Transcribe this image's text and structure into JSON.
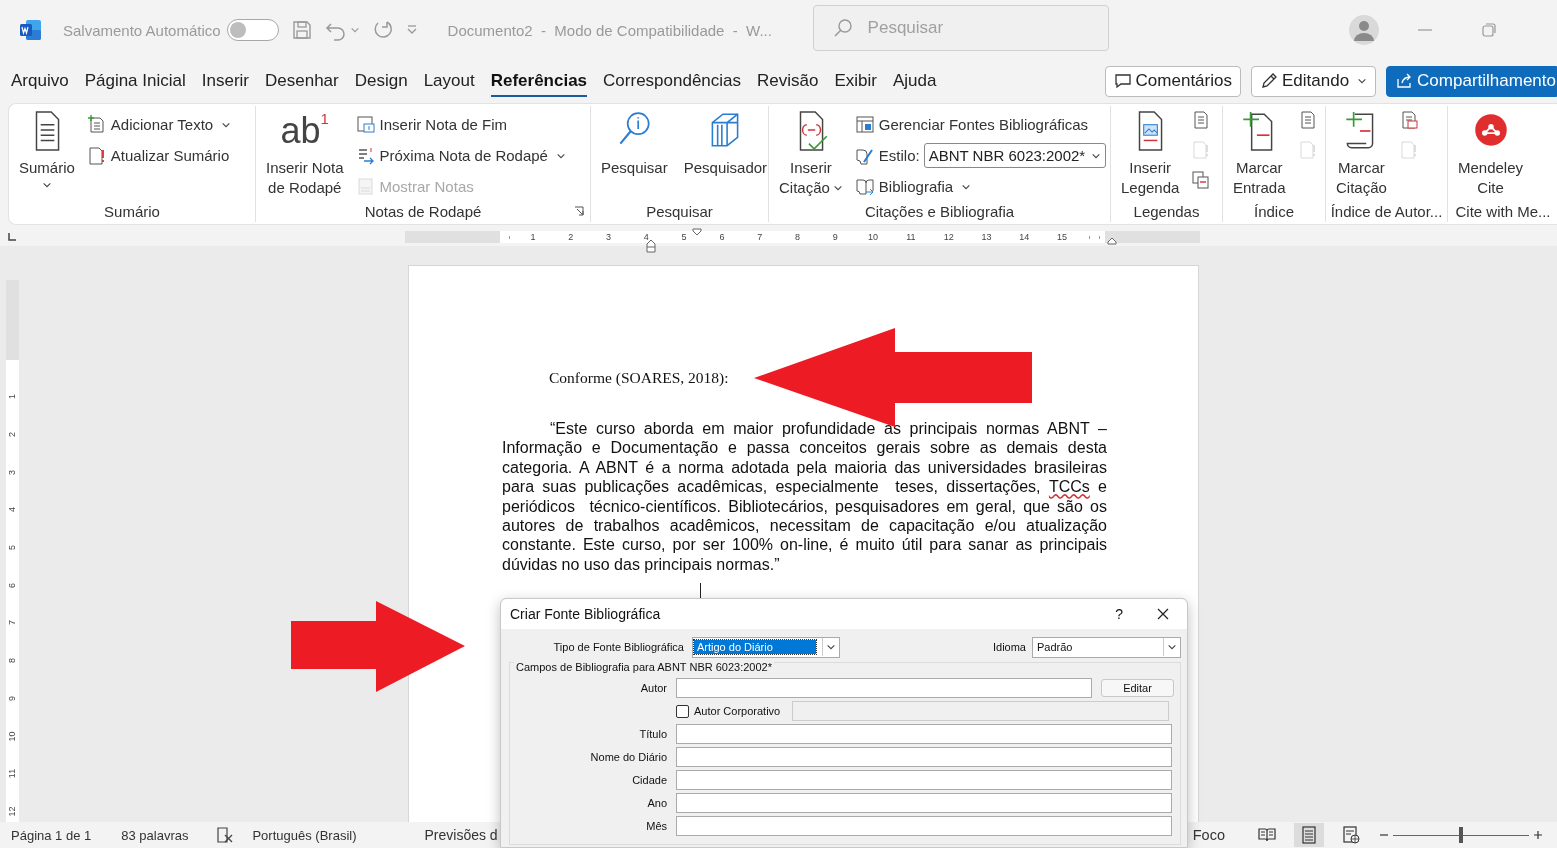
{
  "title_bar": {
    "autosave_label": "Salvamento Automático",
    "autosave_on": false,
    "document_title": "Documento2  -  Modo de Compatibilidade  -  W...",
    "search_placeholder": "Pesquisar"
  },
  "tabs": [
    {
      "label": "Arquivo",
      "selected": false
    },
    {
      "label": "Página Inicial",
      "selected": false
    },
    {
      "label": "Inserir",
      "selected": false
    },
    {
      "label": "Desenhar",
      "selected": false
    },
    {
      "label": "Design",
      "selected": false
    },
    {
      "label": "Layout",
      "selected": false
    },
    {
      "label": "Referências",
      "selected": true
    },
    {
      "label": "Correspondências",
      "selected": false
    },
    {
      "label": "Revisão",
      "selected": false
    },
    {
      "label": "Exibir",
      "selected": false
    },
    {
      "label": "Ajuda",
      "selected": false
    }
  ],
  "header_actions": [
    {
      "kind": "comments",
      "label": "Comentários"
    },
    {
      "kind": "mode",
      "label": "Editando"
    },
    {
      "kind": "share",
      "label": "Compartilhamento"
    }
  ],
  "ribbon_groups": [
    {
      "label": "Sumário",
      "launcher": false,
      "items": [
        {
          "kind": "large",
          "label": "Sumário",
          "menu": true,
          "disabled": false
        },
        {
          "kind": "small",
          "label": "Adicionar Texto",
          "menu": true,
          "disabled": false
        },
        {
          "kind": "small",
          "label": "Atualizar Sumário",
          "disabled": false
        }
      ]
    },
    {
      "label": "Notas de Rodapé",
      "launcher": true,
      "items": [
        {
          "kind": "large",
          "label": "Inserir Nota\nde Rodapé",
          "glyph": "ab",
          "glyph_mark": "1",
          "disabled": false
        },
        {
          "kind": "small",
          "label": "Inserir Nota de Fim",
          "disabled": false
        },
        {
          "kind": "small",
          "label": "Próxima Nota de Rodapé",
          "menu": true,
          "disabled": false
        },
        {
          "kind": "small",
          "label": "Mostrar Notas",
          "disabled": true
        }
      ]
    },
    {
      "label": "Pesquisar",
      "launcher": false,
      "items": [
        {
          "kind": "large",
          "label": "Pesquisar",
          "disabled": false
        },
        {
          "kind": "large",
          "label": "Pesquisador",
          "disabled": false
        }
      ]
    },
    {
      "label": "Citações e Bibliografia",
      "launcher": false,
      "items": [
        {
          "kind": "large",
          "label": "Inserir\nCitação",
          "menu": true,
          "disabled": false
        },
        {
          "kind": "small",
          "label": "Gerenciar Fontes Bibliográficas",
          "disabled": false
        },
        {
          "kind": "select",
          "label": "Estilo:",
          "value": "ABNT NBR 6023:2002*",
          "disabled": false
        },
        {
          "kind": "small",
          "label": "Bibliografia",
          "menu": true,
          "disabled": false
        }
      ]
    },
    {
      "label": "Legendas",
      "launcher": false,
      "items": [
        {
          "kind": "large",
          "label": "Inserir\nLegenda",
          "disabled": false
        },
        {
          "kind": "icon",
          "disabled": false
        },
        {
          "kind": "icon",
          "disabled": true
        },
        {
          "kind": "icon",
          "disabled": false
        }
      ]
    },
    {
      "label": "Índice",
      "launcher": false,
      "items": [
        {
          "kind": "large",
          "label": "Marcar\nEntrada",
          "disabled": false
        },
        {
          "kind": "icon",
          "disabled": false
        },
        {
          "kind": "icon",
          "disabled": true
        }
      ]
    },
    {
      "label": "Índice de Autor...",
      "launcher": false,
      "items": [
        {
          "kind": "large",
          "label": "Marcar\nCitação",
          "disabled": false
        },
        {
          "kind": "icon",
          "disabled": false
        },
        {
          "kind": "icon",
          "disabled": true
        }
      ]
    },
    {
      "label": "Cite with Me...",
      "launcher": false,
      "items": [
        {
          "kind": "large",
          "label": "Mendeley\nCite",
          "disabled": false
        }
      ]
    }
  ],
  "ruler": {
    "h_numbers": [
      "1",
      "2",
      "3",
      "4",
      "5",
      "6",
      "7",
      "8",
      "9",
      "10",
      "11",
      "12",
      "13",
      "14",
      "15"
    ],
    "v_numbers": [
      "1",
      "2",
      "3",
      "4",
      "5",
      "6",
      "7",
      "8",
      "9",
      "10",
      "11",
      "12"
    ]
  },
  "document": {
    "lead": "Conforme (SOARES, 2018):",
    "quote": [
      {
        "text": "“Este curso aborda em maior profundidade as principais normas ABNT – Informação e Documentação e passa conceitos gerais sobre as demais desta categoria. A ABNT é a norma adotada pela maioria das universidades brasileiras para suas publicações acadêmicas, especialmente  teses, dissertações, ",
        "misspelled": false
      },
      {
        "text": "TCCs",
        "misspelled": true
      },
      {
        "text": " e  periódicos  técnico-científicos. Bibliotecários, pesquisadores em geral, que são os autores de trabalhos acadêmicos, necessitam de capacitação e/ou atualização constante. Este curso, por ser 100% on-line, é muito útil para sanar as principais dúvidas no uso das principais normas.”",
        "misspelled": false
      }
    ]
  },
  "dialog": {
    "title": "Criar Fonte Bibliográfica",
    "help": "?",
    "source_type": {
      "label": "Tipo de Fonte Bibliográfica",
      "value": "Artigo do Diário"
    },
    "language": {
      "label": "Idioma",
      "value": "Padrão"
    },
    "fields_title": "Campos de Bibliografia para ABNT NBR 6023:2002*",
    "fields": [
      {
        "kind": "text",
        "label": "Autor",
        "button": "Editar"
      },
      {
        "kind": "checkbox",
        "label": "Autor Corporativo",
        "checked": false
      },
      {
        "kind": "text",
        "label": "Título"
      },
      {
        "kind": "text",
        "label": "Nome do Diário"
      },
      {
        "kind": "text",
        "label": "Cidade"
      },
      {
        "kind": "text",
        "label": "Ano"
      },
      {
        "kind": "text",
        "label": "Mês"
      }
    ]
  },
  "status_bar": {
    "page": "Página 1 de 1",
    "words": "83 palavras",
    "language": "Português (Brasil)",
    "predictions": "Previsões d",
    "focus": "Foco",
    "view_buttons": [
      {
        "selected": false
      },
      {
        "selected": true
      },
      {
        "selected": false
      }
    ],
    "zoom": {
      "level": 0.5
    }
  }
}
